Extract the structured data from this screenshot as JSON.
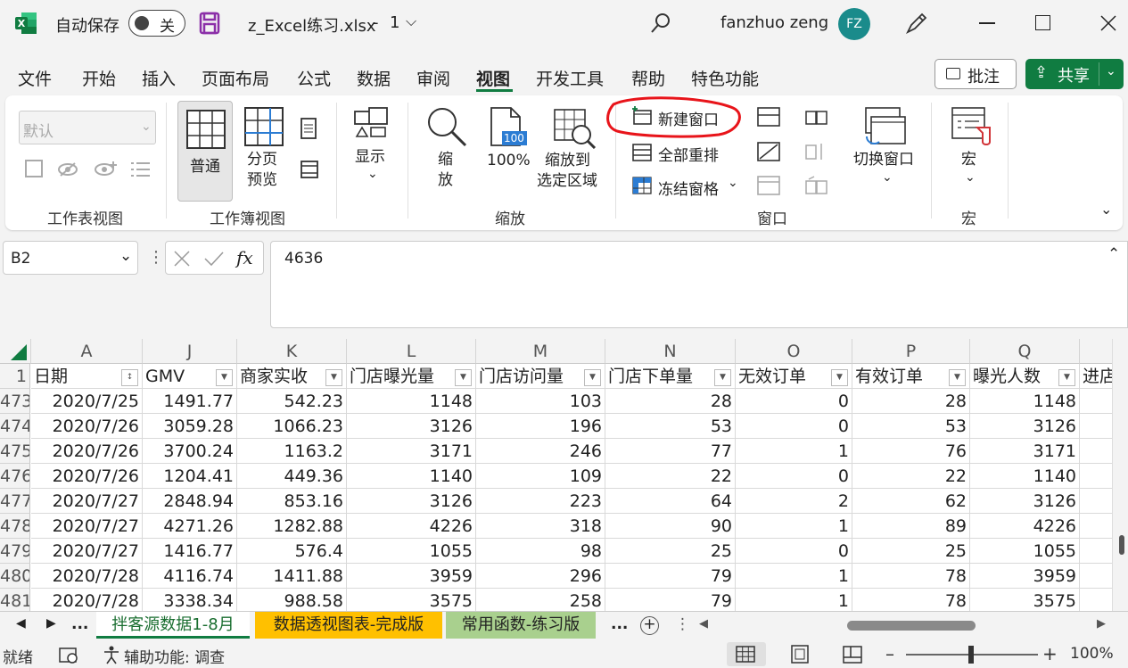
{
  "titlebar": {
    "autosave_label": "自动保存",
    "autosave_state": "关",
    "filename": "z_Excel练习.xlsx",
    "separator": "-",
    "version": "1",
    "user_name": "fanzhuo zeng",
    "user_initials": "FZ"
  },
  "menu": {
    "items": [
      "文件",
      "开始",
      "插入",
      "页面布局",
      "公式",
      "数据",
      "审阅",
      "视图",
      "开发工具",
      "帮助",
      "特色功能"
    ],
    "active": "视图",
    "comment_btn": "批注",
    "share_btn": "共享"
  },
  "ribbon": {
    "sheet_view_dropdown": "默认",
    "group_sheet_view": "工作表视图",
    "normal": "普通",
    "page_break": [
      "分页",
      "预览"
    ],
    "group_workbook_view": "工作簿视图",
    "show": "显示",
    "zoom": [
      "缩",
      "放"
    ],
    "zoom100": "100%",
    "zoom100_icon": "100",
    "zoom_selection": [
      "缩放到",
      "选定区域"
    ],
    "group_zoom": "缩放",
    "new_window": "新建窗口",
    "arrange_all": "全部重排",
    "freeze_panes": "冻结窗格",
    "group_window": "窗口",
    "switch_window": "切换窗口",
    "macros": "宏",
    "group_macros": "宏"
  },
  "formula_bar": {
    "name_box": "B2",
    "fx": "fx",
    "value": "4636"
  },
  "sheet": {
    "corner": "",
    "columns": [
      {
        "letter": "A",
        "header": "日期",
        "align": "left"
      },
      {
        "letter": "J",
        "header": "GMV",
        "align": "right"
      },
      {
        "letter": "K",
        "header": "商家实收",
        "align": "right"
      },
      {
        "letter": "L",
        "header": "门店曝光量",
        "align": "right"
      },
      {
        "letter": "M",
        "header": "门店访问量",
        "align": "right"
      },
      {
        "letter": "N",
        "header": "门店下单量",
        "align": "right"
      },
      {
        "letter": "O",
        "header": "无效订单",
        "align": "right"
      },
      {
        "letter": "P",
        "header": "有效订单",
        "align": "right"
      },
      {
        "letter": "Q",
        "header": "曝光人数",
        "align": "right"
      },
      {
        "letter": "",
        "header": "进店",
        "align": "left"
      }
    ],
    "header_row_num": "1",
    "rows": [
      {
        "num": "473",
        "cells": [
          "2020/7/25",
          "1491.77",
          "542.23",
          "1148",
          "103",
          "28",
          "0",
          "28",
          "1148",
          ""
        ]
      },
      {
        "num": "474",
        "cells": [
          "2020/7/26",
          "3059.28",
          "1066.23",
          "3126",
          "196",
          "53",
          "0",
          "53",
          "3126",
          ""
        ]
      },
      {
        "num": "475",
        "cells": [
          "2020/7/26",
          "3700.24",
          "1163.2",
          "3171",
          "246",
          "77",
          "1",
          "76",
          "3171",
          ""
        ]
      },
      {
        "num": "476",
        "cells": [
          "2020/7/26",
          "1204.41",
          "449.36",
          "1140",
          "109",
          "22",
          "0",
          "22",
          "1140",
          ""
        ]
      },
      {
        "num": "477",
        "cells": [
          "2020/7/27",
          "2848.94",
          "853.16",
          "3126",
          "223",
          "64",
          "2",
          "62",
          "3126",
          ""
        ]
      },
      {
        "num": "478",
        "cells": [
          "2020/7/27",
          "4271.26",
          "1282.88",
          "4226",
          "318",
          "90",
          "1",
          "89",
          "4226",
          ""
        ]
      },
      {
        "num": "479",
        "cells": [
          "2020/7/27",
          "1416.77",
          "576.4",
          "1055",
          "98",
          "25",
          "0",
          "25",
          "1055",
          ""
        ]
      },
      {
        "num": "480",
        "cells": [
          "2020/7/28",
          "4116.74",
          "1411.88",
          "3959",
          "296",
          "79",
          "1",
          "78",
          "3959",
          ""
        ]
      },
      {
        "num": "481",
        "cells": [
          "2020/7/28",
          "3338.34",
          "988.58",
          "3575",
          "258",
          "79",
          "1",
          "78",
          "3575",
          ""
        ]
      }
    ]
  },
  "tabs": {
    "ellipsis": "...",
    "items": [
      {
        "label": "拌客源数据1-8月",
        "color": "#a9d08e",
        "text": "#1a6e30"
      },
      {
        "label": "数据透视图表-完成版",
        "color": "#ffc000",
        "text": "#222"
      },
      {
        "label": "常用函数-练习版",
        "color": "#a9d08e",
        "text": "#222"
      }
    ],
    "more": "...",
    "add": "+"
  },
  "status": {
    "ready": "就绪",
    "accessibility": "辅助功能: 调查",
    "zoom_minus": "–",
    "zoom_plus": "+",
    "zoom": "100%"
  },
  "colors": {
    "excel_green": "#107c41",
    "active_tab_underline": "#107c41",
    "annotation_red": "#e8141a",
    "avatar_bg": "#1a8b8b"
  }
}
